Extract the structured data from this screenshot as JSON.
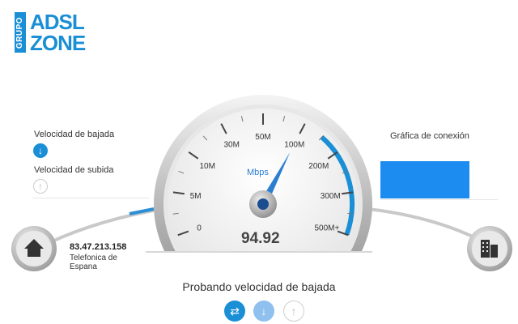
{
  "logo": {
    "grupo": "GRUPO",
    "line1": "ADSL",
    "line2": "ZONE"
  },
  "left_panel": {
    "download_label": "Velocidad de bajada",
    "upload_label": "Velocidad de subida",
    "download_icon": "arrow-down-icon",
    "upload_icon": "arrow-up-icon"
  },
  "right_panel": {
    "graph_label": "Gráfica de conexión",
    "graph_color": "#1c8cf0"
  },
  "gauge": {
    "unit": "Mbps",
    "value": "94.92",
    "needle_mbps": 100,
    "ticks": [
      "0",
      "5M",
      "10M",
      "30M",
      "50M",
      "100M",
      "200M",
      "300M",
      "500M+"
    ],
    "accent": "#1a8fd6"
  },
  "connection": {
    "ip": "83.47.213.158",
    "isp_line1": "Telefonica de",
    "isp_line2": "Espana",
    "home_icon": "home-icon",
    "server_icon": "building-icon"
  },
  "status": {
    "text": "Probando velocidad de bajada"
  },
  "controls": [
    {
      "name": "swap-icon"
    },
    {
      "name": "arrow-down-icon"
    },
    {
      "name": "arrow-up-icon"
    }
  ]
}
